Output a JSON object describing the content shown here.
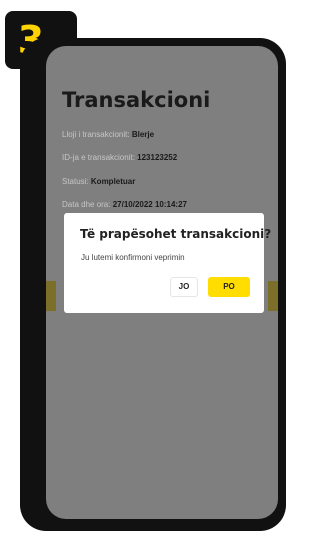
{
  "step": {
    "number": "3"
  },
  "screen": {
    "title": "Transakcioni",
    "rows": [
      {
        "label": "Lloji i transakcionit: ",
        "value": "Blerje"
      },
      {
        "label": "ID-ja e transakcionit: ",
        "value": "123123252"
      },
      {
        "label": "Statusi: ",
        "value": "Kompletuar"
      },
      {
        "label": "Data dhe ora: ",
        "value": "27/10/2022 10:14:27"
      }
    ]
  },
  "dialog": {
    "title": "Të prapësohet transakcioni?",
    "message": "Ju lutemi konfirmoni veprimin",
    "no_label": "JO",
    "yes_label": "PO"
  },
  "colors": {
    "accent": "#ffdd00",
    "badge_background": "#111111",
    "overlay": "#7f7f7f"
  }
}
